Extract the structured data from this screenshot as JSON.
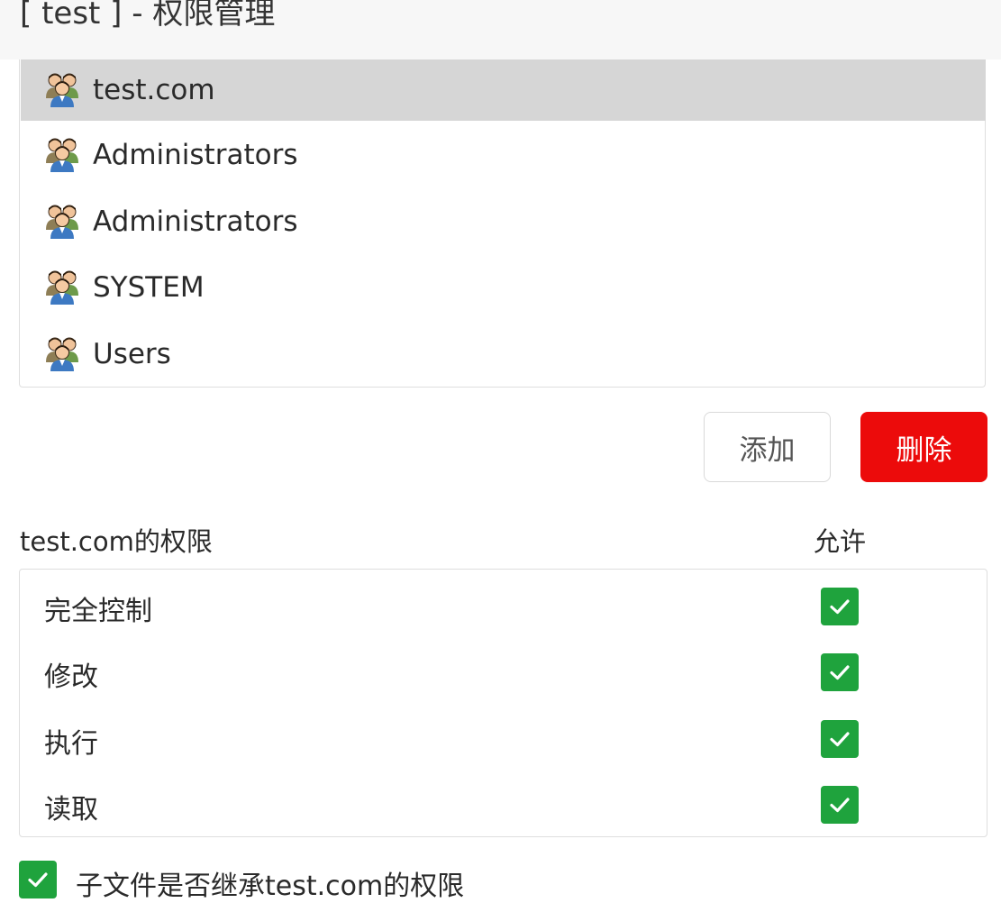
{
  "window": {
    "title": "[ test ] - 权限管理"
  },
  "principals": [
    {
      "name": "test.com",
      "icon": "user-group-icon",
      "selected": true
    },
    {
      "name": "Administrators",
      "icon": "user-group-icon",
      "selected": false
    },
    {
      "name": "Administrators",
      "icon": "user-group-icon",
      "selected": false
    },
    {
      "name": "SYSTEM",
      "icon": "user-group-icon",
      "selected": false
    },
    {
      "name": "Users",
      "icon": "user-group-icon",
      "selected": false
    }
  ],
  "actions": {
    "add_label": "添加",
    "delete_label": "删除"
  },
  "permissions": {
    "heading": "test.com的权限",
    "allow_heading": "允许",
    "rows": [
      {
        "label": "完全控制",
        "allowed": true
      },
      {
        "label": "修改",
        "allowed": true
      },
      {
        "label": "执行",
        "allowed": true
      },
      {
        "label": "读取",
        "allowed": true
      }
    ]
  },
  "inherit": {
    "label": "子文件是否继承test.com的权限",
    "checked": true
  },
  "colors": {
    "accent_green": "#1fa33d",
    "danger_red": "#ec0b0b",
    "selected_row": "#d6d6d6"
  }
}
